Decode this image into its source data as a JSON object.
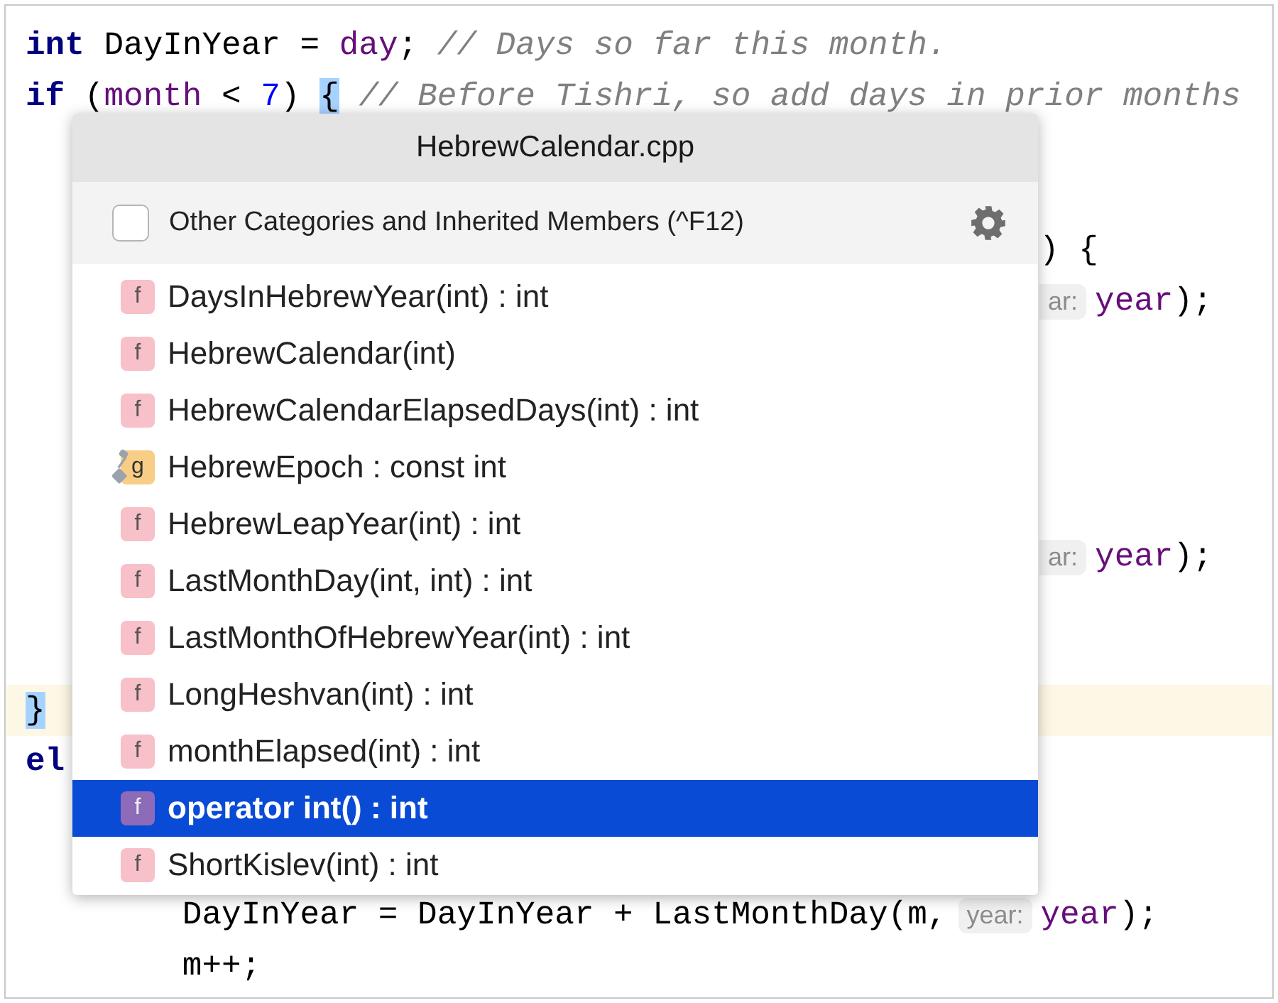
{
  "editor": {
    "lines": [
      {
        "kind": "top",
        "current": false,
        "segments": [
          {
            "kind": "keyword",
            "text": "int"
          },
          {
            "kind": "plain",
            "text": " DayInYear = "
          },
          {
            "kind": "field",
            "text": "day"
          },
          {
            "kind": "plain",
            "text": "; "
          },
          {
            "kind": "comment",
            "text": "// Days so far this month."
          }
        ]
      },
      {
        "kind": "top",
        "current": false,
        "segments": [
          {
            "kind": "keyword",
            "text": "if"
          },
          {
            "kind": "plain",
            "text": " ("
          },
          {
            "kind": "field",
            "text": "month"
          },
          {
            "kind": "plain",
            "text": " < "
          },
          {
            "kind": "number",
            "text": "7"
          },
          {
            "kind": "plain",
            "text": ") "
          },
          {
            "kind": "brace-match",
            "text": "{"
          },
          {
            "kind": "comment",
            "text": "// Before Tishri, so add days in prior months"
          }
        ]
      },
      {
        "kind": "empty"
      },
      {
        "kind": "empty"
      },
      {
        "kind": "after-popup",
        "current": false,
        "segments": [
          {
            "kind": "plain",
            "text": ") {"
          }
        ]
      },
      {
        "kind": "after-popup",
        "current": false,
        "segments": [
          {
            "kind": "hint",
            "text": "ar:"
          },
          {
            "kind": "field",
            "text": "year"
          },
          {
            "kind": "plain",
            "text": ");"
          }
        ]
      },
      {
        "kind": "empty"
      },
      {
        "kind": "empty"
      },
      {
        "kind": "empty"
      },
      {
        "kind": "empty"
      },
      {
        "kind": "after-popup",
        "current": false,
        "segments": [
          {
            "kind": "hint",
            "text": "ar:"
          },
          {
            "kind": "field",
            "text": "year"
          },
          {
            "kind": "plain",
            "text": ");"
          }
        ]
      },
      {
        "kind": "empty"
      },
      {
        "kind": "empty"
      },
      {
        "kind": "top",
        "current": true,
        "segments": [
          {
            "kind": "brace-match",
            "text": "}"
          }
        ]
      },
      {
        "kind": "top",
        "current": false,
        "segments": [
          {
            "kind": "keyword",
            "text": "el"
          }
        ]
      },
      {
        "kind": "empty"
      },
      {
        "kind": "empty"
      },
      {
        "kind": "nested",
        "current": false,
        "segments": [
          {
            "kind": "plain",
            "text": "DayInYear = DayInYear + LastMonthDay(m,"
          },
          {
            "kind": "hint",
            "text": "year:"
          },
          {
            "kind": "field",
            "text": "year"
          },
          {
            "kind": "plain",
            "text": ");"
          }
        ]
      },
      {
        "kind": "nested",
        "current": false,
        "segments": [
          {
            "kind": "plain",
            "text": "m++;"
          }
        ]
      }
    ]
  },
  "popup": {
    "title": "HebrewCalendar.cpp",
    "option": {
      "label": "Other Categories and Inherited Members (^F12)",
      "checked": false
    },
    "members": [
      {
        "kind": "function",
        "icon": "f",
        "label": "DaysInHebrewYear(int) : int",
        "selected": false
      },
      {
        "kind": "function",
        "icon": "f",
        "label": "HebrewCalendar(int)",
        "selected": false
      },
      {
        "kind": "function",
        "icon": "f",
        "label": "HebrewCalendarElapsedDays(int) : int",
        "selected": false
      },
      {
        "kind": "variable",
        "icon": "g",
        "label": "HebrewEpoch : const int",
        "selected": false
      },
      {
        "kind": "function",
        "icon": "f",
        "label": "HebrewLeapYear(int) : int",
        "selected": false
      },
      {
        "kind": "function",
        "icon": "f",
        "label": "LastMonthDay(int, int) : int",
        "selected": false
      },
      {
        "kind": "function",
        "icon": "f",
        "label": "LastMonthOfHebrewYear(int) : int",
        "selected": false
      },
      {
        "kind": "function",
        "icon": "f",
        "label": "LongHeshvan(int) : int",
        "selected": false
      },
      {
        "kind": "function",
        "icon": "f",
        "label": "monthElapsed(int) : int",
        "selected": false
      },
      {
        "kind": "function",
        "icon": "f",
        "label": "operator int() : int",
        "selected": true
      },
      {
        "kind": "function",
        "icon": "f",
        "label": "ShortKislev(int) : int",
        "selected": false
      }
    ]
  }
}
